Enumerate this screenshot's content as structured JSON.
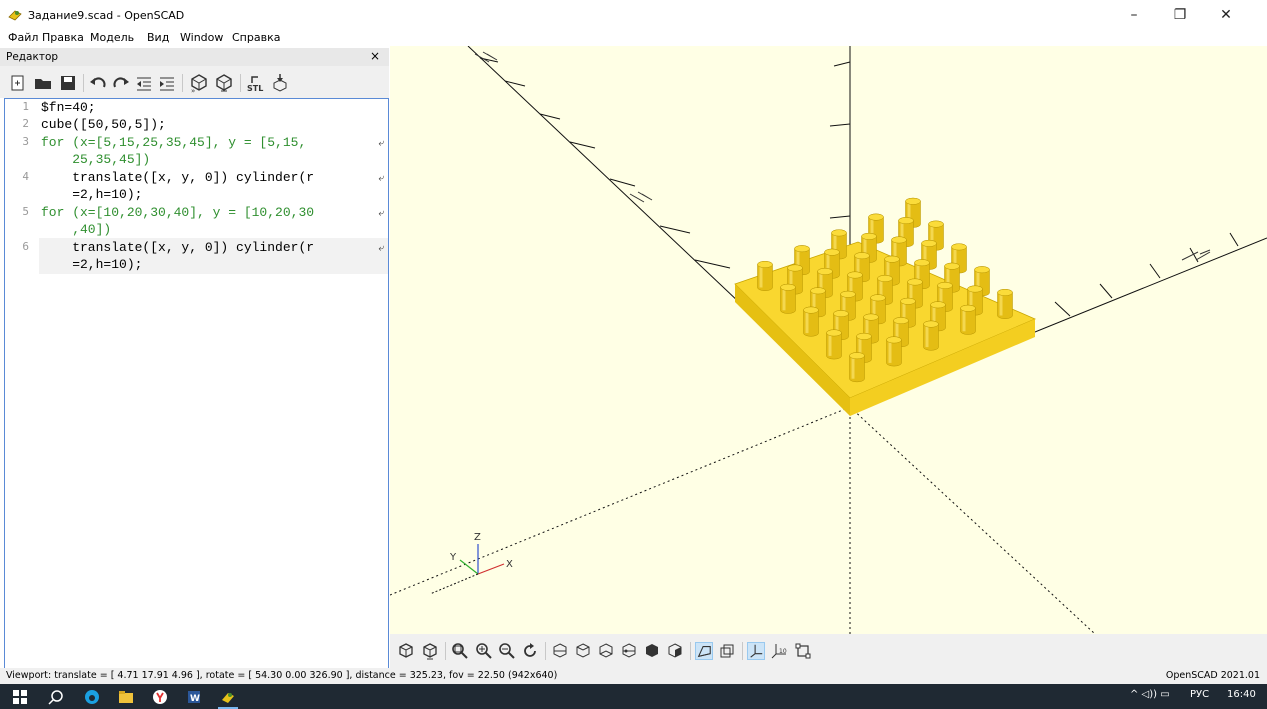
{
  "window": {
    "title": "Задание9.scad - OpenSCAD",
    "minimize_glyph": "–",
    "restore_glyph": "❐",
    "close_glyph": "✕"
  },
  "menu": [
    "Файл",
    "Правка",
    "Модель",
    "Вид",
    "Window",
    "Справка"
  ],
  "editor": {
    "title": "Редактор",
    "close_glyph": "×",
    "toolbar_icons": [
      "new-file-icon",
      "open-file-icon",
      "save-icon",
      "undo-icon",
      "redo-icon",
      "unindent-icon",
      "indent-icon",
      "preview-icon",
      "render-icon",
      "export-stl-icon",
      "send-to-print-icon"
    ],
    "line_numbers": [
      "1",
      "2",
      "3",
      "4",
      "5",
      "6"
    ],
    "code_lines": [
      "$fn=40;",
      "cube([50,50,5]);",
      "for (x=[5,15,25,35,45], y = [5,15,",
      "    25,35,45])",
      "    translate([x, y, 0]) cylinder(r",
      "    =2,h=10);",
      "for (x=[10,20,30,40], y = [10,20,30",
      "    ,40])",
      "    translate([x, y, 0]) cylinder(r",
      "    =2,h=10);"
    ]
  },
  "viewport": {
    "background": "#ffffe5",
    "model_color": "#f9d72f",
    "axis_labels": {
      "x": "X",
      "y": "Y",
      "z": "Z"
    },
    "toolbar_icons": [
      "preview-icon",
      "render-icon",
      "view-all-icon",
      "zoom-in-icon",
      "zoom-out-icon",
      "reset-view-icon",
      "view-right-icon",
      "view-top-icon",
      "view-bottom-icon",
      "view-left-icon",
      "view-front-icon",
      "view-back-icon",
      "perspective-icon",
      "orthogonal-icon",
      "show-axes-icon",
      "show-scale-markers-icon",
      "show-edges-icon"
    ]
  },
  "status": {
    "viewport_text": "Viewport: translate = [ 4.71 17.91 4.96 ], rotate = [ 54.30 0.00 326.90 ], distance = 325.23, fov = 22.50 (942x640)",
    "version": "OpenSCAD 2021.01"
  },
  "taskbar": {
    "tray_text": "РУС",
    "time": "16:40"
  }
}
